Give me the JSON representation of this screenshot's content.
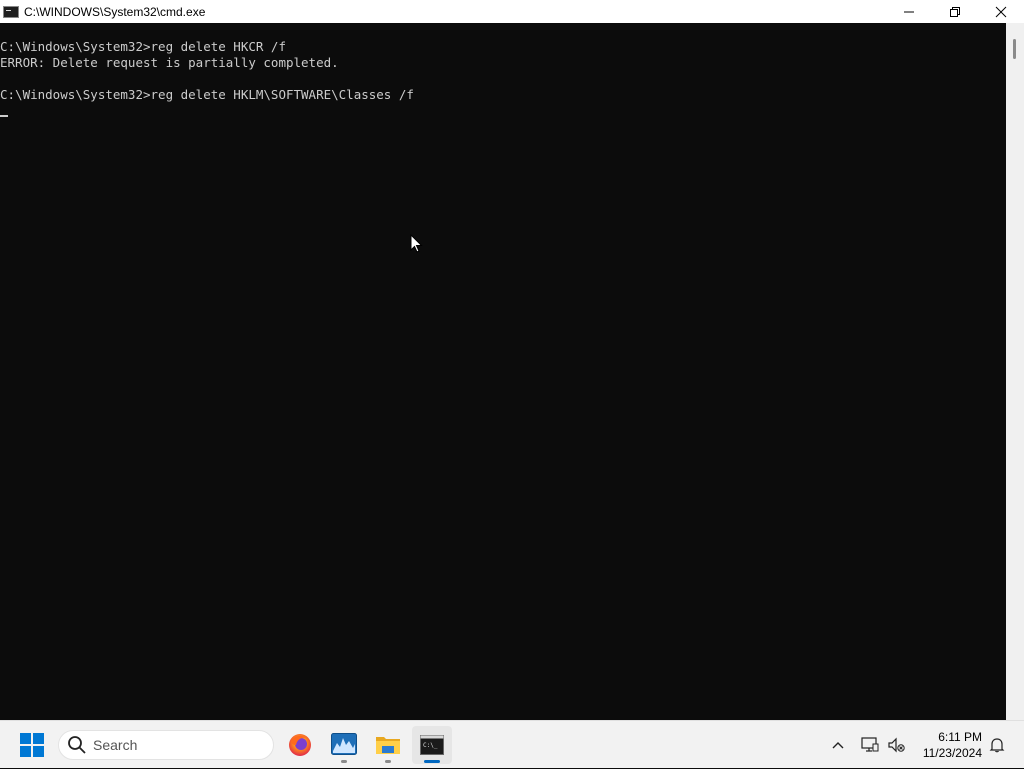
{
  "window": {
    "title": "C:\\WINDOWS\\System32\\cmd.exe",
    "icon": "cmd-icon",
    "controls": {
      "minimize": "minimize-icon",
      "maximize": "restore-icon",
      "close": "close-icon"
    }
  },
  "console": {
    "lines": [
      "C:\\Windows\\System32>reg delete HKCR /f",
      "ERROR: Delete request is partially completed.",
      "",
      "C:\\Windows\\System32>reg delete HKLM\\SOFTWARE\\Classes /f"
    ],
    "text_color": "#cccccc",
    "background": "#0c0c0c"
  },
  "taskbar": {
    "search_placeholder": "Search",
    "apps": [
      {
        "name": "firefox",
        "icon": "firefox-icon",
        "running": false
      },
      {
        "name": "task-manager",
        "icon": "chart-app-icon",
        "running": true
      },
      {
        "name": "file-explorer",
        "icon": "folder-icon",
        "running": true
      },
      {
        "name": "command-prompt",
        "icon": "terminal-icon",
        "running": true,
        "active": true
      }
    ],
    "tray": {
      "overflow": "chevron-up-icon",
      "network": "network-icon",
      "volume": "volume-muted-icon",
      "notifications": "bell-icon"
    },
    "clock": {
      "time": "6:11 PM",
      "date": "11/23/2024"
    },
    "accent": "#0067c0"
  }
}
